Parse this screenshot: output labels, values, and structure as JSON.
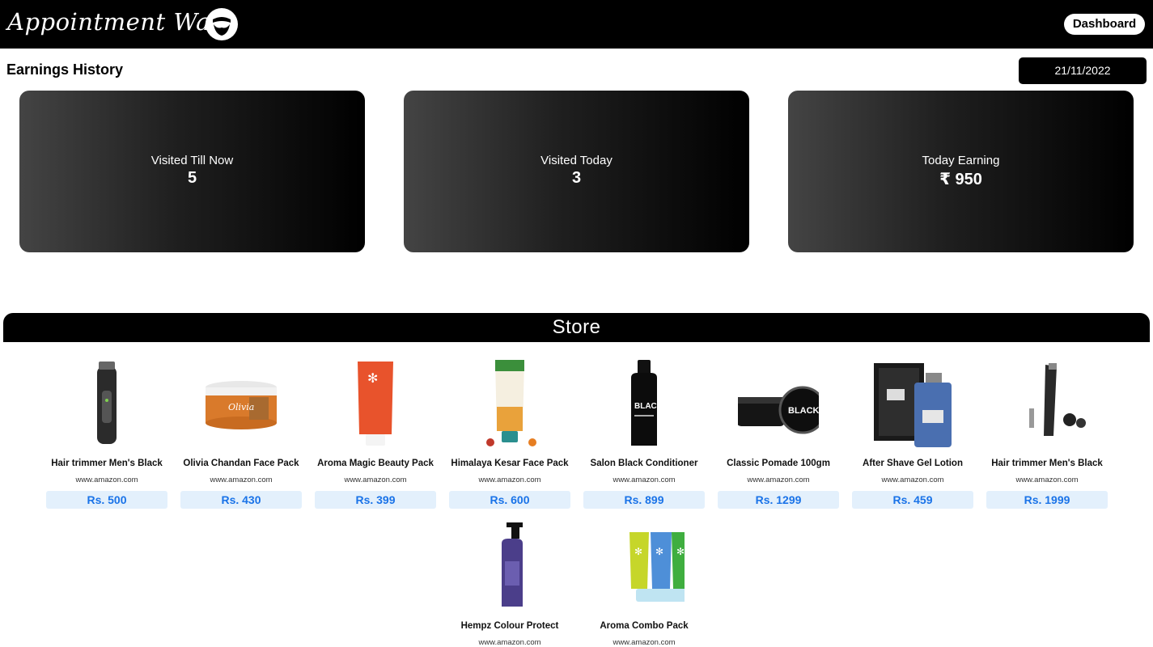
{
  "header": {
    "brand": "Appointment Wale",
    "dashboard_label": "Dashboard"
  },
  "earnings": {
    "title": "Earnings History",
    "date": "21/11/2022",
    "cards": [
      {
        "label": "Visited Till Now",
        "value": "5"
      },
      {
        "label": "Visited Today",
        "value": "3"
      },
      {
        "label": "Today Earning",
        "value": "₹ 950"
      }
    ]
  },
  "store": {
    "title": "Store",
    "products": [
      {
        "name": "Hair trimmer Men's Black",
        "source": "www.amazon.com",
        "price": "Rs. 500",
        "icon": "trimmer"
      },
      {
        "name": "Olivia Chandan Face Pack",
        "source": "www.amazon.com",
        "price": "Rs. 430",
        "icon": "jar"
      },
      {
        "name": "Aroma Magic Beauty Pack",
        "source": "www.amazon.com",
        "price": "Rs. 399",
        "icon": "tube-orange"
      },
      {
        "name": "Himalaya Kesar Face Pack",
        "source": "www.amazon.com",
        "price": "Rs. 600",
        "icon": "tube-white"
      },
      {
        "name": "Salon Black Conditioner",
        "source": "www.amazon.com",
        "price": "Rs. 899",
        "icon": "bottle-black"
      },
      {
        "name": "Classic Pomade 100gm",
        "source": "www.amazon.com",
        "price": "Rs. 1299",
        "icon": "pomade"
      },
      {
        "name": "After Shave Gel Lotion",
        "source": "www.amazon.com",
        "price": "Rs. 459",
        "icon": "perfume"
      },
      {
        "name": "Hair trimmer Men's Black",
        "source": "www.amazon.com",
        "price": "Rs. 1999",
        "icon": "trimmer-kit"
      },
      {
        "name": "Hempz Colour Protect",
        "source": "www.amazon.com",
        "price": "",
        "icon": "pump-bottle"
      },
      {
        "name": "Aroma Combo Pack",
        "source": "www.amazon.com",
        "price": "",
        "icon": "combo-tubes"
      }
    ]
  }
}
